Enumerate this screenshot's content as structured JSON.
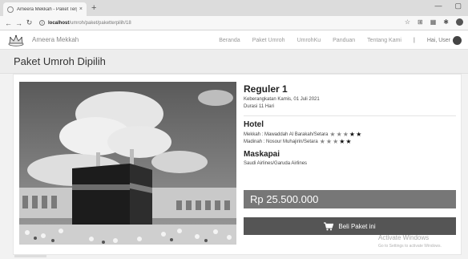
{
  "browser": {
    "tab_title": "Ameera Mekkah - Paket Terpilih",
    "tab_close": "×",
    "new_tab": "+",
    "url_host": "localhost",
    "url_path": "/umroh/paket/paketterpilih/18",
    "icons": [
      "back-icon",
      "forward-icon",
      "reload-icon",
      "info-icon",
      "star-icon",
      "extensions-icon",
      "puzzle-icon",
      "profile-icon",
      "minimize-icon",
      "maximize-icon"
    ]
  },
  "navbar": {
    "brand": "Ameera Mekkah",
    "items": [
      {
        "label": "Beranda"
      },
      {
        "label": "Paket Umroh"
      },
      {
        "label": "UmrohKu"
      },
      {
        "label": "Panduan"
      },
      {
        "label": "Tentang Kami"
      }
    ],
    "separator": "|",
    "user_greeting": "Hai, User"
  },
  "page": {
    "title": "Paket Umroh Dipilih"
  },
  "package": {
    "name": "Reguler 1",
    "departure": "Keberangkatan Kamis, 01 Juli 2021",
    "duration": "Durasi 11 Hari",
    "hotel_heading": "Hotel",
    "hotels": [
      {
        "label": "Mekkah : Mawaddah Al Barakah/Setara",
        "stars_on": 2,
        "stars_dim": 3
      },
      {
        "label": "Madinah : Nosour Muhajirin/Setara",
        "stars_on": 2,
        "stars_dim": 3
      }
    ],
    "airline_heading": "Maskapai",
    "airline": "Saudi Airlines/Garuda Airlines",
    "price": "Rp 25.500.000",
    "buy_label": "Beli Paket ini"
  },
  "watermark": {
    "title": "Activate Windows",
    "subtitle": "Go to Settings to activate Windows."
  }
}
